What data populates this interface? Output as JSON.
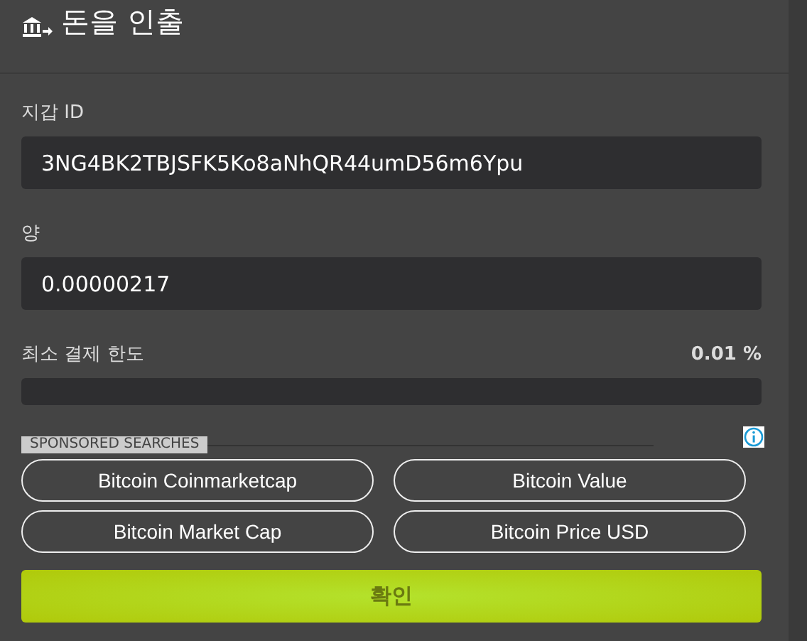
{
  "header": {
    "title": "돈을 인출"
  },
  "fields": [
    {
      "label": "지갑 ID",
      "value": "3NG4BK2TBJSFK5Ko8aNhQR44umD56m6Ypu"
    },
    {
      "label": "양",
      "value": "0.00000217"
    }
  ],
  "limit": {
    "label": "최소 결제 한도",
    "reading": "0.01 %",
    "level": 0
  },
  "sponsored": {
    "label": "SPONSORED SEARCHES",
    "links": [
      "Bitcoin Coinmarketcap",
      "Bitcoin Value",
      "Bitcoin Market Cap",
      "Bitcoin Price USD"
    ]
  },
  "confirm": {
    "label": "확인"
  }
}
